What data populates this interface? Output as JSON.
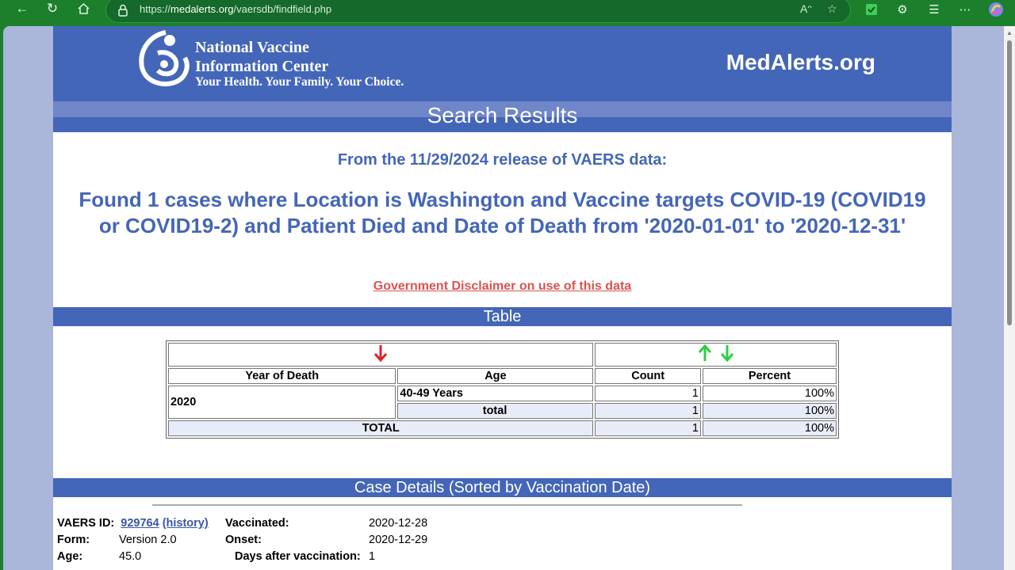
{
  "browser": {
    "url_prefix": "https://",
    "url_domain": "medalerts.org",
    "url_path": "/vaersdb/findfield.php",
    "accent": "#1b7f2b"
  },
  "header": {
    "org_line1": "National Vaccine",
    "org_line2": "Information Center",
    "tagline": "Your Health. Your Family. Your Choice.",
    "site_name": "MedAlerts.org",
    "page_title": "Search Results",
    "brand_color": "#4466b8"
  },
  "summary": {
    "release": "From the 11/29/2024 release of VAERS data:",
    "found": "Found 1 cases where Location is Washington and Vaccine targets COVID-19 (COVID19 or COVID19-2) and Patient Died and Date of Death from '2020-01-01' to '2020-12-31'",
    "disclaimer": "Government Disclaimer on use of this data"
  },
  "table": {
    "section_title": "Table",
    "headers": [
      "Year of Death",
      "Age",
      "Count",
      "Percent"
    ],
    "group_year": "2020",
    "rows": [
      {
        "age": "40-49 Years",
        "count": "1",
        "percent": "100%"
      },
      {
        "age": "total",
        "count": "1",
        "percent": "100%"
      }
    ],
    "total_label": "TOTAL",
    "total_count": "1",
    "total_percent": "100%",
    "sort_down_color": "#e0202a",
    "sort_color": "#2ecc40"
  },
  "case_details": {
    "section_title": "Case Details (Sorted by Vaccination Date)",
    "vaers_id_label": "VAERS ID:",
    "vaers_id": "929764",
    "history_link": "(history)",
    "form_label": "Form:",
    "form": "Version 2.0",
    "age_label": "Age:",
    "age": "45.0",
    "vaccinated_label": "Vaccinated:",
    "vaccinated": "2020-12-28",
    "onset_label": "Onset:",
    "onset": "2020-12-29",
    "days_after_label": "Days after vaccination:",
    "days_after": "1"
  }
}
